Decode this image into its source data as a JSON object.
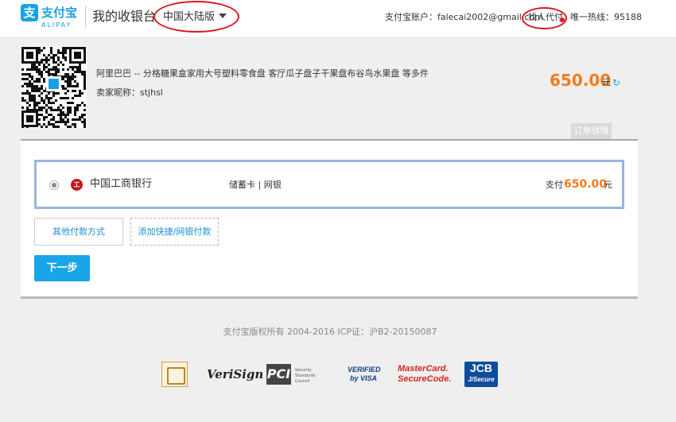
{
  "header": {
    "logo_cn": "支付宝",
    "logo_en": "ALIPAY",
    "page_title": "我的收银台",
    "region": "中国大陆版",
    "account_label": "支付宝账户：",
    "account_email": "falecai2002@gmail.com",
    "find_payer": "找人代付",
    "hotline_label": "唯一热线：",
    "hotline_number": "95188",
    "highlight_color": "#e0141e"
  },
  "order": {
    "product_title": "阿里巴巴 -- 分格糖果盒家用大号塑料零食盘 客厅瓜子盘子干果盘布谷鸟水果盘 等多件",
    "seller_label": "卖家昵称：",
    "seller_name": "stjhsl",
    "amount": "650.00",
    "currency": "元",
    "details_tab": "订单详情",
    "amount_color": "#f37b1d"
  },
  "payment": {
    "bank_name": "中国工商银行",
    "card_type": "储蓄卡 | 网银",
    "pay_label": "支付",
    "pay_amount": "650.00",
    "pay_unit": "元",
    "other_methods": "其他付款方式",
    "add_quick": "添加快捷/网银付款",
    "next_button": "下一步",
    "accent_color": "#1aa5e8"
  },
  "footer": {
    "copyright": "支付宝版权所有 2004-2016 ICP证：沪B2-20150087",
    "badges": {
      "verisign": "VeriSign",
      "pci": "PCI",
      "pci_sub": "Security Standards Council",
      "visa_line1": "VERIFIED",
      "visa_line2": "by VISA",
      "mc_line1": "MasterCard.",
      "mc_line2": "SecureCode.",
      "jcb_line1": "JCB",
      "jcb_line2": "J/Secure"
    }
  }
}
